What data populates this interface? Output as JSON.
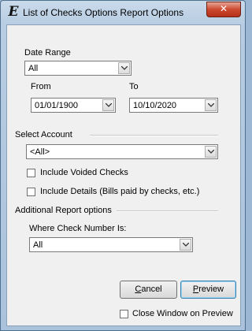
{
  "window": {
    "title": "List of Checks Options Report Options",
    "close_label": "✕"
  },
  "date_range": {
    "label": "Date Range",
    "value": "All"
  },
  "from": {
    "label": "From",
    "value": "01/01/1900"
  },
  "to": {
    "label": "To",
    "value": "10/10/2020"
  },
  "account": {
    "label": "Select Account",
    "value": "<All>"
  },
  "options": {
    "include_voided": {
      "label": "Include Voided Checks",
      "checked": false
    },
    "include_details": {
      "label": "Include Details (Bills paid by checks, etc.)",
      "checked": false
    }
  },
  "additional": {
    "label": "Additional Report options",
    "check_number_label": "Where Check Number Is:",
    "check_number_value": "All"
  },
  "buttons": {
    "cancel_accel": "C",
    "cancel_rest": "ancel",
    "preview_accel": "P",
    "preview_rest": "review"
  },
  "close_on_preview": {
    "label": "Close Window on Preview",
    "checked": false
  }
}
